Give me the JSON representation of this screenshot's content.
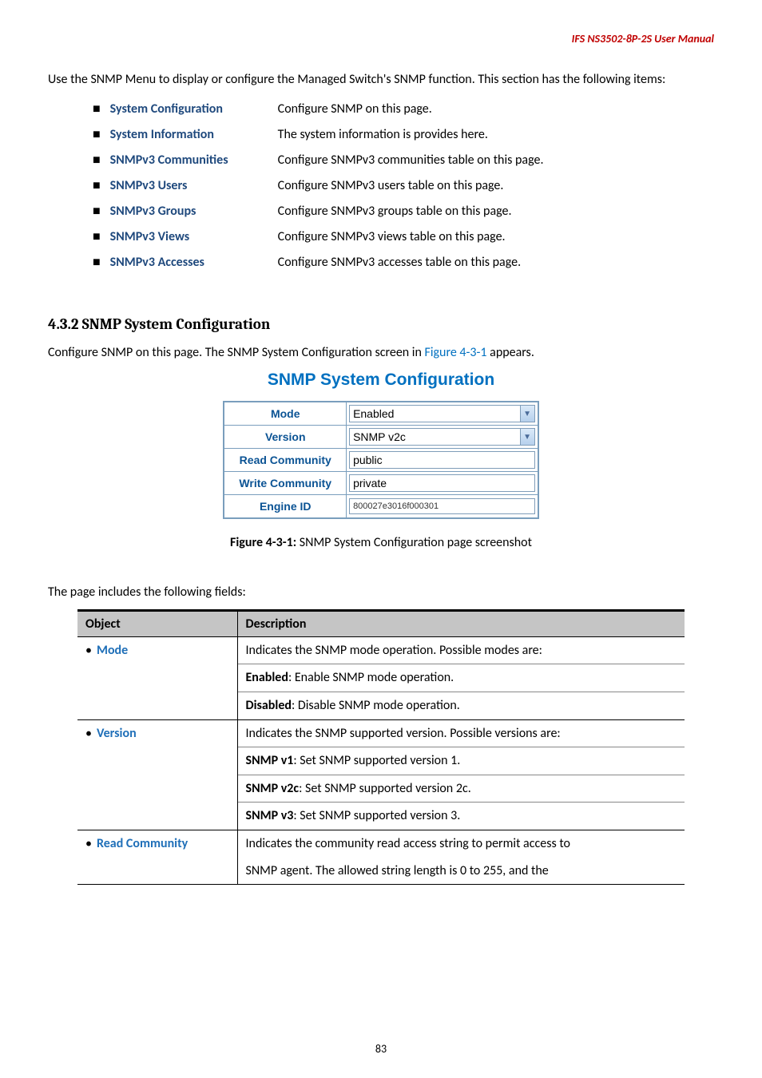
{
  "header": {
    "doc_title": "IFS  NS3502-8P-2S  User  Manual"
  },
  "intro": {
    "p1": "Use the SNMP Menu to display or configure the Managed Switch's SNMP function. This section has the following items:"
  },
  "items": [
    {
      "label": "System Configuration",
      "desc": "Configure SNMP on this page."
    },
    {
      "label": "System Information",
      "desc": "The system information is provides here."
    },
    {
      "label": "SNMPv3 Communities",
      "desc": "Configure SNMPv3 communities table on this page."
    },
    {
      "label": "SNMPv3 Users",
      "desc": "Configure SNMPv3 users table on this page."
    },
    {
      "label": "SNMPv3 Groups",
      "desc": "Configure SNMPv3 groups table on this page."
    },
    {
      "label": "SNMPv3 Views",
      "desc": "Configure SNMPv3 views table on this page."
    },
    {
      "label": "SNMPv3 Accesses",
      "desc": "Configure SNMPv3 accesses table on this page."
    }
  ],
  "section": {
    "heading": "4.3.2 SNMP System Configuration",
    "intro_a": "Configure SNMP on this page. The SNMP System Configuration screen in ",
    "intro_link": "Figure 4-3-1",
    "intro_b": " appears."
  },
  "config": {
    "title": "SNMP System Configuration",
    "rows": {
      "mode_label": "Mode",
      "mode_value": "Enabled",
      "version_label": "Version",
      "version_value": "SNMP v2c",
      "read_label": "Read Community",
      "read_value": "public",
      "write_label": "Write Community",
      "write_value": "private",
      "engine_label": "Engine ID",
      "engine_value": "800027e3016f000301"
    }
  },
  "figure": {
    "caption_bold": "Figure 4-3-1:",
    "caption_rest": " SNMP System Configuration page screenshot"
  },
  "fields_intro": "The page includes the following fields:",
  "fields": {
    "header_object": "Object",
    "header_desc": "Description",
    "mode": {
      "name": "Mode",
      "line1": "Indicates the SNMP mode operation. Possible modes are:",
      "enabled_b": "Enabled",
      "enabled_t": ": Enable SNMP mode operation.",
      "disabled_b": "Disabled",
      "disabled_t": ": Disable SNMP mode operation."
    },
    "version": {
      "name": "Version",
      "line1": "Indicates the SNMP supported version. Possible versions are:",
      "v1_b": "SNMP v1",
      "v1_t": ": Set SNMP supported version 1.",
      "v2_b": "SNMP v2c",
      "v2_t": ": Set SNMP supported version 2c.",
      "v3_b": "SNMP v3",
      "v3_t": ": Set SNMP supported version 3."
    },
    "read": {
      "name": "Read Community",
      "line1": "Indicates the community read access string to permit access to",
      "line2": "SNMP agent. The allowed string length is 0 to 255, and the"
    }
  },
  "page_number": "83"
}
